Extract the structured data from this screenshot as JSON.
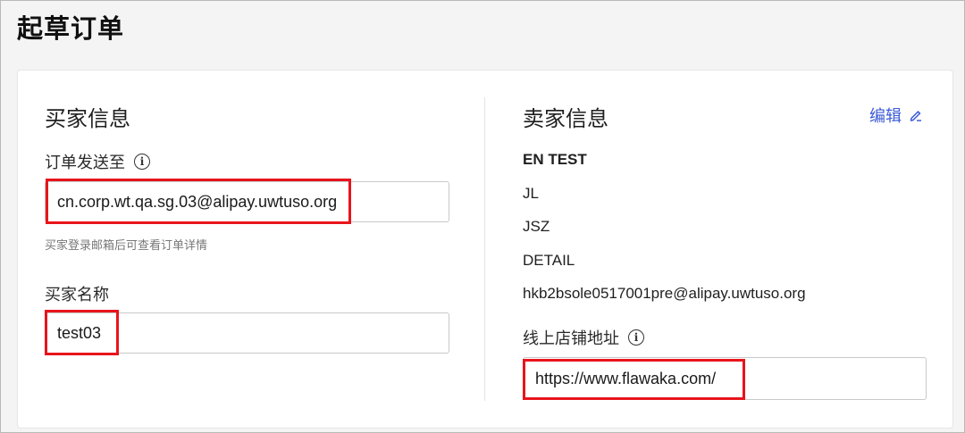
{
  "page": {
    "title": "起草订单"
  },
  "buyer": {
    "section_title": "买家信息",
    "send_to_label": "订单发送至",
    "send_to_value": "cn.corp.wt.qa.sg.03@alipay.uwtuso.org",
    "send_to_hint": "买家登录邮箱后可查看订单详情",
    "name_label": "买家名称",
    "name_value": "test03"
  },
  "seller": {
    "section_title": "卖家信息",
    "edit_label": "编辑",
    "lines": [
      "EN TEST",
      "JL",
      "JSZ",
      "DETAIL",
      "hkb2bsole0517001pre@alipay.uwtuso.org"
    ],
    "store_url_label": "线上店铺地址",
    "store_url_value": "https://www.flawaka.com/"
  },
  "icons": {
    "info": "info-circle-icon",
    "edit": "pencil-icon"
  },
  "colors": {
    "link": "#3b5bd6",
    "highlight": "#e8141c"
  }
}
